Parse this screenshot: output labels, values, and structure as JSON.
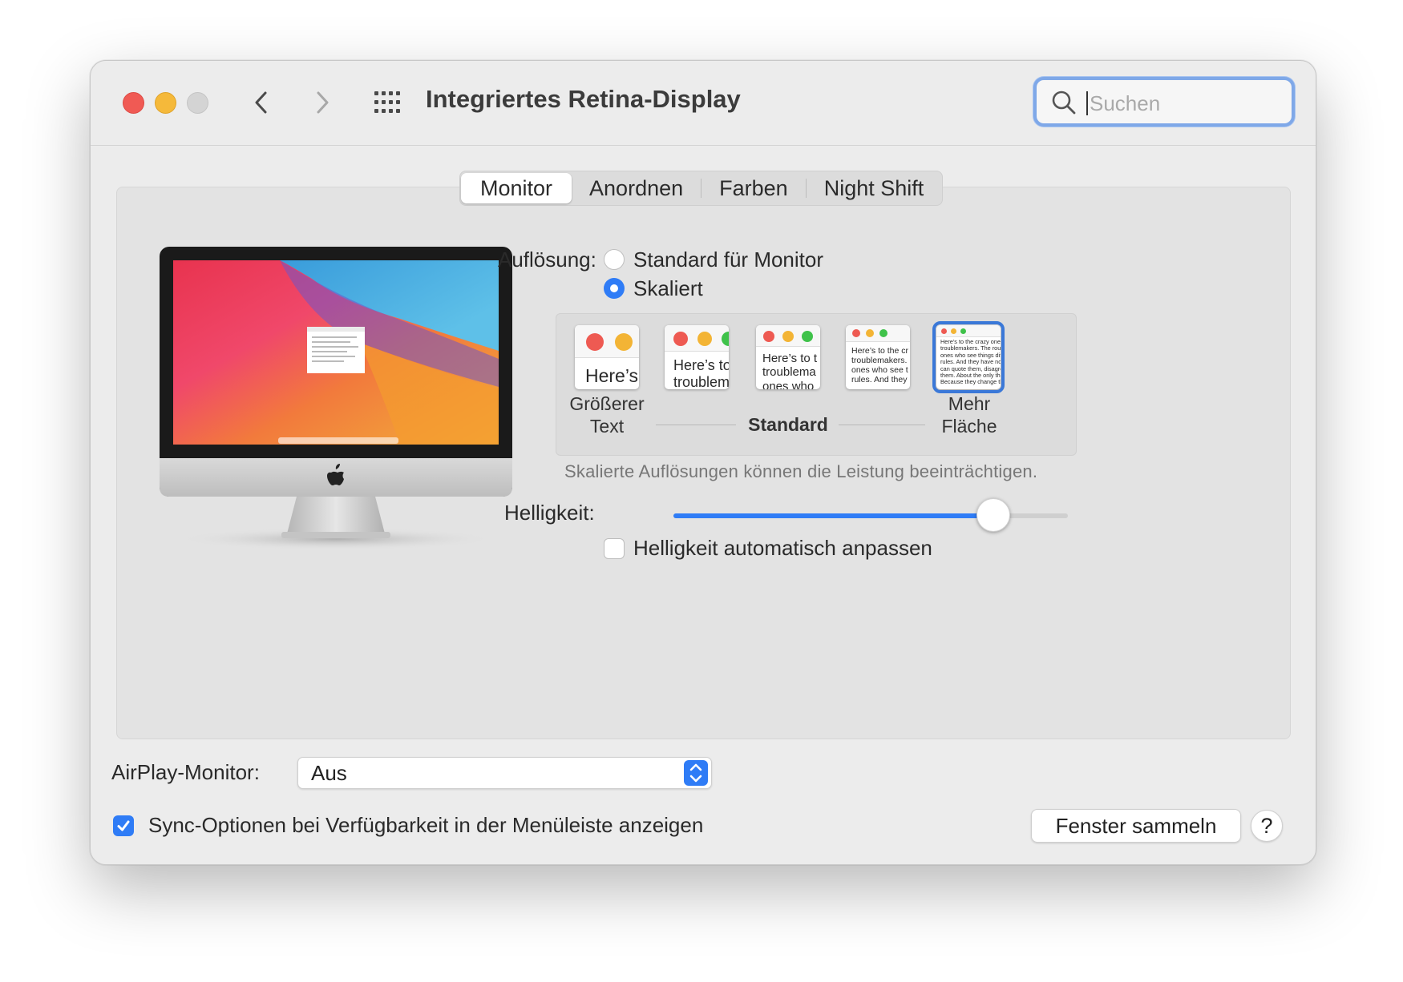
{
  "window": {
    "title": "Integriertes Retina-Display",
    "search_placeholder": "Suchen"
  },
  "tabs": [
    {
      "label": "Monitor",
      "active": true
    },
    {
      "label": "Anordnen",
      "active": false
    },
    {
      "label": "Farben",
      "active": false
    },
    {
      "label": "Night Shift",
      "active": false
    }
  ],
  "resolution": {
    "label": "Auflösung:",
    "options": [
      {
        "label": "Standard für Monitor",
        "selected": false
      },
      {
        "label": "Skaliert",
        "selected": true
      }
    ],
    "scale_options": [
      {
        "sample": "Here’s",
        "selected": false
      },
      {
        "sample": "Here’s to\ntroublem",
        "selected": false
      },
      {
        "sample": "Here’s to t\ntroublema\nones who",
        "selected": false
      },
      {
        "sample": "Here’s to the cr\ntroublemakers.\nones who see t\nrules. And they",
        "selected": false
      },
      {
        "sample": "Here’s to the crazy one\ntroublemakers. The rou\nones who see things dif\nrules. And they have no\ncan quote them, disagre\nthem. About the only th\nBecause they change th",
        "selected": true
      }
    ],
    "scale_left_label": "Größerer Text",
    "scale_left_label_1": "Größerer",
    "scale_left_label_2": "Text",
    "scale_mid_label": "Standard",
    "scale_right_label_1": "Mehr",
    "scale_right_label_2": "Fläche",
    "hint": "Skalierte Auflösungen können die Leistung beeinträchtigen."
  },
  "brightness": {
    "label": "Helligkeit:",
    "level": 0.81,
    "auto_label": "Helligkeit automatisch anpassen",
    "auto_checked": false
  },
  "airplay": {
    "label": "AirPlay-Monitor:",
    "value": "Aus"
  },
  "sync": {
    "label": "Sync-Optionen bei Verfügbarkeit in der Menüleiste anzeigen",
    "checked": true
  },
  "buttons": {
    "gather": "Fenster sammeln",
    "help": "?"
  },
  "colors": {
    "accent": "#2f7cf6",
    "close": "#f05a54",
    "minimize": "#f5b93a"
  }
}
